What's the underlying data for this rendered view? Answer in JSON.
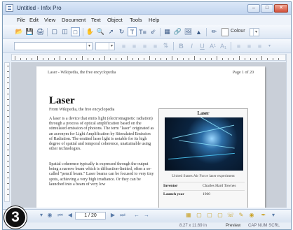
{
  "window": {
    "title": "Untitled - Infix Pro"
  },
  "menu": [
    "File",
    "Edit",
    "View",
    "Document",
    "Text",
    "Object",
    "Tools",
    "Help"
  ],
  "toolbar": {
    "colour_label": "Colour"
  },
  "document": {
    "running_head": "Laser - Wikipedia, the free encyclopedia",
    "page_count": "Page 1 of 20",
    "title": "Laser",
    "subtitle": "From Wikipedia, the free encyclopedia",
    "para1": "A laser is a device that emits light (electromagnetic radiation) through a process of optical amplification based on the stimulated emission of photons. The term \"laser\" originated as an acronym for Light Amplification by Stimulated Emission of Radiation. The emitted laser light is notable for its high degree of spatial and temporal coherence, unattainable using other technologies.",
    "para2": "Spatial coherence typically is expressed through the output being a narrow beam which is diffraction-limited, often a so-called \"pencil beam.\" Laser beams can be focused to very tiny spots, achieving a very high irradiance. Or they can be launched into a beam of very low"
  },
  "infobox": {
    "title": "Laser",
    "caption": "United States Air Force laser experiment",
    "rows": [
      {
        "key": "Inventor",
        "value": "Charles Hard Townes"
      },
      {
        "key": "Launch year",
        "value": "1960"
      }
    ]
  },
  "nav": {
    "page_field": "1 / 20"
  },
  "status": {
    "dimensions": "8.27 x 11.69 in",
    "mode": "Preview",
    "indicators": "CAP NUM SCRL"
  },
  "callout": {
    "number": "3"
  }
}
